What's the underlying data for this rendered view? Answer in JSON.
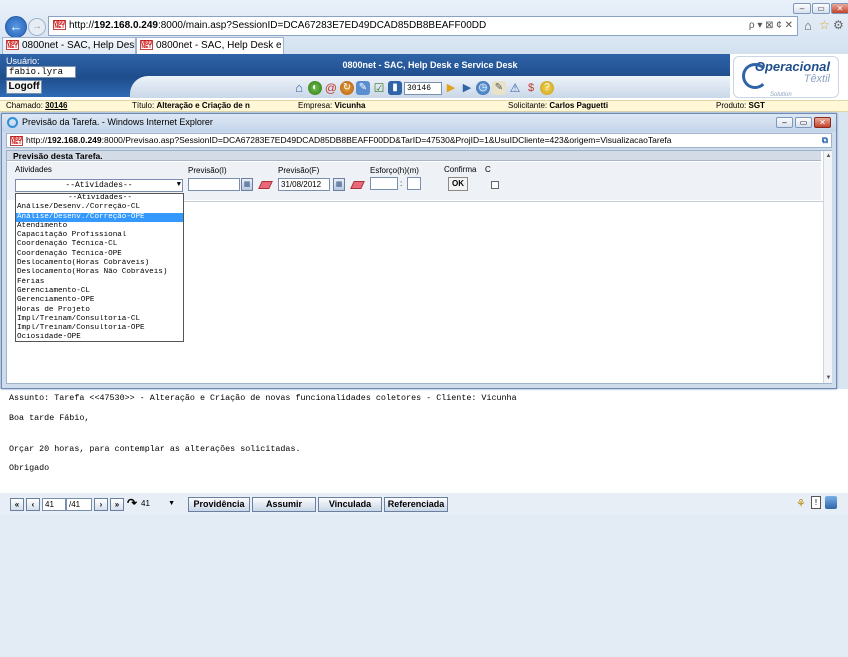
{
  "browser": {
    "address": "http://192.168.0.249:8000/main.asp?SessionID=DCA67283E7ED49DCAD85DB8BEAFF00DD",
    "address_domain": "192.168.0.249",
    "address_rest": ":8000/main.asp?SessionID=DCA67283E7ED49DCAD85DB8BEAFF00DD",
    "search_hint": "ρ ▾ ⊠ ¢ ✕",
    "tabs": [
      {
        "label": "0800net - SAC, Help Desk e ..."
      },
      {
        "label": "0800net - SAC, Help Desk e Ser..."
      }
    ]
  },
  "app": {
    "user_label": "Usuário:",
    "user_value": "fabio.lyra",
    "logoff_label": "Logoff",
    "title": "0800net - SAC, Help Desk e Service Desk",
    "ticket_number": "30146",
    "logo_main": "Operacional",
    "logo_sub": "Têxtil",
    "logo_tag": "Solution"
  },
  "info_bar": {
    "chamado_label": "Chamado:",
    "chamado_value": "30146",
    "titulo_label": "Título:",
    "titulo_value": "Alteração e Criação de n",
    "empresa_label": "Empresa:",
    "empresa_value": "Vicunha",
    "solicitante_label": "Solicitante:",
    "solicitante_value": "Carlos Paguetti",
    "produto_label": "Produto:",
    "produto_value": "SGT"
  },
  "popup": {
    "window_title": "Previsão da Tarefa. - Windows Internet Explorer",
    "address_domain": "192.168.0.249",
    "address_prefix": "http://",
    "address_rest": ":8000/Previsao.asp?SessionID=DCA67283E7ED49DCAD85DB8BEAFF00DD&TarID=47530&ProjID=1&UsuIDCliente=423&origem=VisualizacaoTarefa",
    "section_title": "Previsão desta Tarefa.",
    "labels": {
      "atividades": "Atividades",
      "previsao_i": "Previsão(I)",
      "previsao_f": "Previsão(F)",
      "esforco": "Esforço(h)(m)",
      "confirma": "Confirma",
      "c": "C"
    },
    "select_value": "--Atividades--",
    "previsao_i_value": "",
    "previsao_f_value": "31/08/2012",
    "esforco_h": "",
    "esforco_m": "",
    "esforco_sep": ":",
    "ok_label": "OK",
    "options": [
      "--Atividades--",
      "Análise/Desenv./Correção-CL",
      "Análise/Desenv./Correção-OPE",
      "Atendimento",
      "Capacitação Profissional",
      "Coordenação Técnica-CL",
      "Coordenação Técnica-OPE",
      "Deslocamento(Horas Cobráveis)",
      "Deslocamento(Horas Não Cobráveis)",
      "Férias",
      "Gerenciamento-CL",
      "Gerenciamento-OPE",
      "Horas de Projeto",
      "Impl/Treinam/Consultoria-CL",
      "Impl/Treinam/Consultoria-OPE",
      "Ociosidade-OPE"
    ],
    "selected_index": 2
  },
  "message": {
    "subject": "Assunto: Tarefa <<47530>> - Alteração e Criação de novas funcionalidades coletores - Cliente: Vicunha",
    "greeting": "Boa tarde Fábio,",
    "body": "Orçar 20 horas, para contemplar as alterações solicitadas.",
    "closing": "Obrigado"
  },
  "bottom_nav": {
    "first": "«",
    "prev": "‹",
    "current": "41",
    "total": "/41",
    "next": "›",
    "last": "»",
    "goto_value": "41",
    "providencia": "Providência",
    "assumir": "Assumir",
    "vinculada": "Vinculada",
    "referenciada": "Referenciada"
  },
  "colors": {
    "header_blue": "#1f4d8c",
    "selection": "#3399ff",
    "info_bar_bg": "#fff7d6"
  }
}
